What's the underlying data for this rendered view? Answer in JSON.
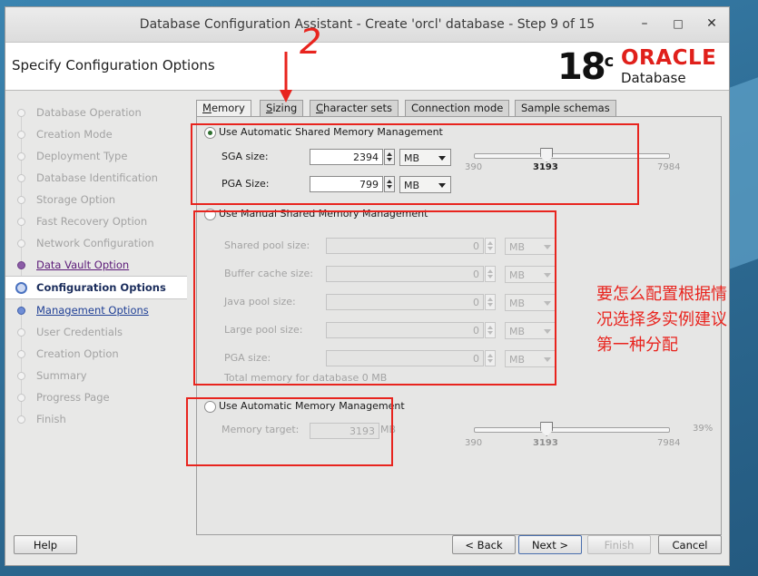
{
  "window": {
    "title": "Database Configuration Assistant - Create 'orcl' database - Step 9 of 15",
    "minimize_icon": "minimize-icon",
    "maximize_icon": "maximize-icon",
    "close_icon": "close-icon"
  },
  "header": {
    "page_title": "Specify Configuration Options",
    "logo_version": "18",
    "logo_sup": "c",
    "logo_brand": "ORACLE",
    "logo_product": "Database"
  },
  "steps": [
    {
      "label": "Database Operation",
      "state": "done"
    },
    {
      "label": "Creation Mode",
      "state": "done"
    },
    {
      "label": "Deployment Type",
      "state": "done"
    },
    {
      "label": "Database Identification",
      "state": "done"
    },
    {
      "label": "Storage Option",
      "state": "done"
    },
    {
      "label": "Fast Recovery Option",
      "state": "done"
    },
    {
      "label": "Network Configuration",
      "state": "done"
    },
    {
      "label": "Data Vault Option",
      "state": "link"
    },
    {
      "label": "Configuration Options",
      "state": "active"
    },
    {
      "label": "Management Options",
      "state": "link"
    },
    {
      "label": "User Credentials",
      "state": "pending"
    },
    {
      "label": "Creation Option",
      "state": "pending"
    },
    {
      "label": "Summary",
      "state": "pending"
    },
    {
      "label": "Progress Page",
      "state": "pending"
    },
    {
      "label": "Finish",
      "state": "pending"
    }
  ],
  "tabs": [
    "Memory",
    "Sizing",
    "Character sets",
    "Connection mode",
    "Sample schemas"
  ],
  "memory": {
    "asmm": {
      "label": "Use Automatic Shared Memory Management",
      "selected": true,
      "sga_label": "SGA size:",
      "sga_value": "2394",
      "sga_unit": "MB",
      "pga_label": "PGA Size:",
      "pga_value": "799",
      "pga_unit": "MB",
      "slider_min": "390",
      "slider_value": "3193",
      "slider_max": "7984",
      "slider_fraction": 0.37
    },
    "manual": {
      "label": "Use Manual Shared Memory Management",
      "selected": false,
      "rows": [
        {
          "label": "Shared pool size:",
          "value": "0",
          "unit": "MB"
        },
        {
          "label": "Buffer cache size:",
          "value": "0",
          "unit": "MB"
        },
        {
          "label": "Java pool size:",
          "value": "0",
          "unit": "MB"
        },
        {
          "label": "Large pool size:",
          "value": "0",
          "unit": "MB"
        },
        {
          "label": "PGA size:",
          "value": "0",
          "unit": "MB"
        }
      ],
      "total": "Total memory for database 0 MB"
    },
    "amm": {
      "label": "Use Automatic Memory Management",
      "selected": false,
      "target_label": "Memory target:",
      "target_value": "3193",
      "target_unit": "MB",
      "slider_min": "390",
      "slider_value": "3193",
      "slider_max": "7984",
      "percent": "39%",
      "slider_fraction": 0.37
    }
  },
  "buttons": {
    "help": "Help",
    "back": "< Back",
    "next": "Next >",
    "finish": "Finish",
    "cancel": "Cancel"
  },
  "annotations": {
    "number": "2",
    "note_line1": "要怎么配置根据情",
    "note_line2": "况选择多实例建议",
    "note_line3": "第一种分配"
  },
  "colors": {
    "annotation_red": "#e8241e",
    "oracle_red": "#e0201b",
    "active_step": "#1b2d5c"
  }
}
